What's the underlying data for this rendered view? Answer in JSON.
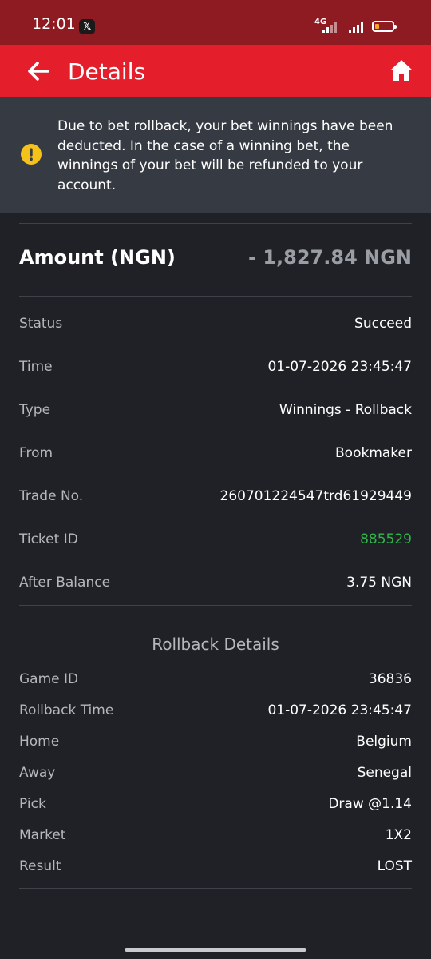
{
  "status_bar": {
    "time": "12:01",
    "app_badge": "𝕏",
    "network": "4G",
    "battery_color": "#f5a623"
  },
  "header": {
    "title": "Details",
    "back_icon": "arrow-left-icon",
    "home_icon": "home-icon"
  },
  "notice": {
    "icon": "exclamation-circle-icon",
    "text": "Due to bet rollback, your bet winnings have been deducted. In the case of a winning bet, the winnings of your bet will be refunded to your account."
  },
  "amount": {
    "label": "Amount (NGN)",
    "value": "- 1,827.84 NGN"
  },
  "details": [
    {
      "label": "Status",
      "value": "Succeed"
    },
    {
      "label": "Time",
      "value": "01-07-2026 23:45:47"
    },
    {
      "label": "Type",
      "value": "Winnings - Rollback"
    },
    {
      "label": "From",
      "value": "Bookmaker"
    },
    {
      "label": "Trade No.",
      "value": "260701224547trd61929449"
    },
    {
      "label": "Ticket ID",
      "value": "885529"
    },
    {
      "label": "After Balance",
      "value": "3.75 NGN"
    }
  ],
  "rollback": {
    "title": "Rollback Details",
    "rows": [
      {
        "label": "Game ID",
        "value": "36836"
      },
      {
        "label": "Rollback Time",
        "value": "01-07-2026 23:45:47"
      },
      {
        "label": "Home",
        "value": "Belgium"
      },
      {
        "label": "Away",
        "value": "Senegal"
      },
      {
        "label": "Pick",
        "value": "Draw @1.14"
      },
      {
        "label": "Market",
        "value": "1X2"
      },
      {
        "label": "Result",
        "value": "LOST"
      }
    ]
  },
  "colors": {
    "status_bar": "#8e1b22",
    "header": "#e41e2b",
    "notice_bg": "#363a42",
    "page_bg": "#1f2126",
    "ticket_link": "#2fb54a",
    "warning_icon": "#f4c21a"
  }
}
